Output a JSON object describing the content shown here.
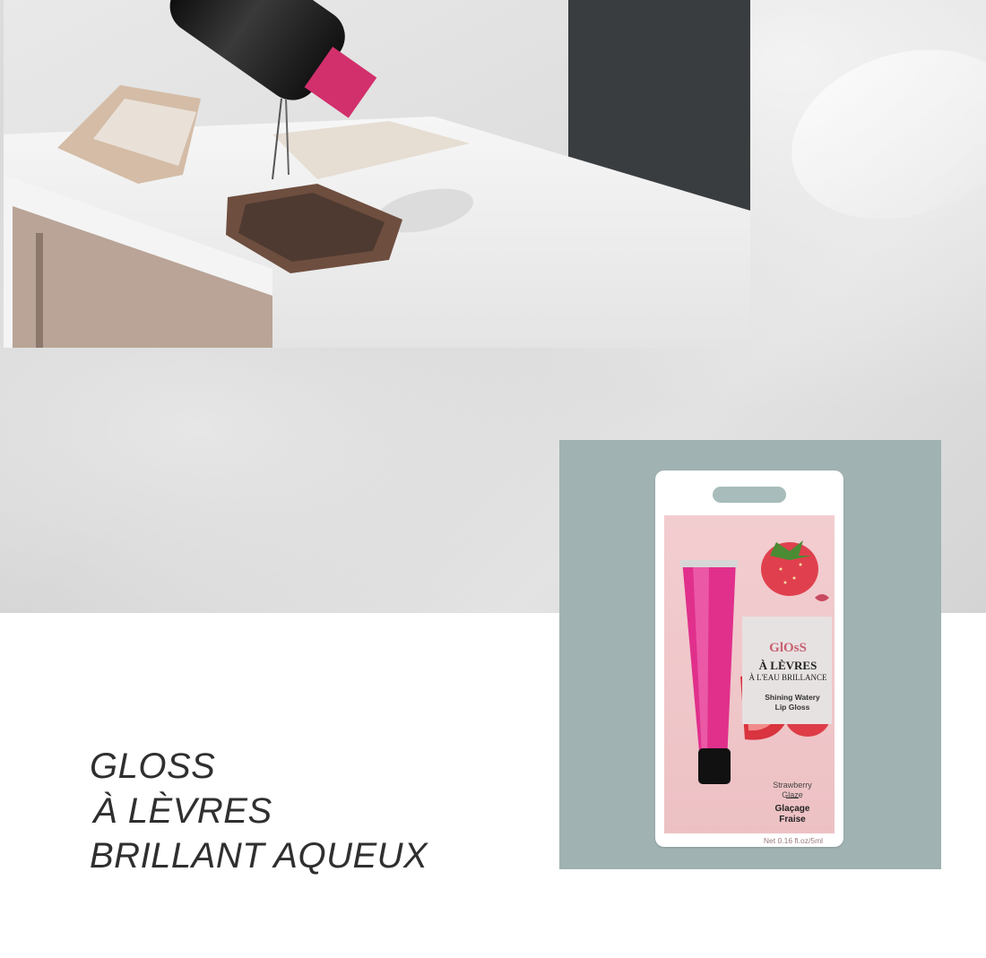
{
  "tagline": {
    "line1": "GLOSS",
    "line2": "À LÈVRES",
    "line3": "BRILLANT AQUEUX"
  },
  "product": {
    "brand": "GlOsS",
    "title": "À LÈVRES",
    "subtitle": "À L'EAU BRILLANCE",
    "description_line1": "Shining Watery",
    "description_line2": "Lip Gloss",
    "flavor_en_line1": "Strawberry",
    "flavor_en_line2": "Glaze",
    "flavor_fr_line1": "Glaçage",
    "flavor_fr_line2": "Fraise",
    "net": "Net 0.16 fl.oz/5ml"
  },
  "colors": {
    "panel": "#a0b2b2",
    "card_pink": "#f2cdd0",
    "gloss_pink": "#e0308c",
    "tagline_text": "#2f2f2f"
  }
}
